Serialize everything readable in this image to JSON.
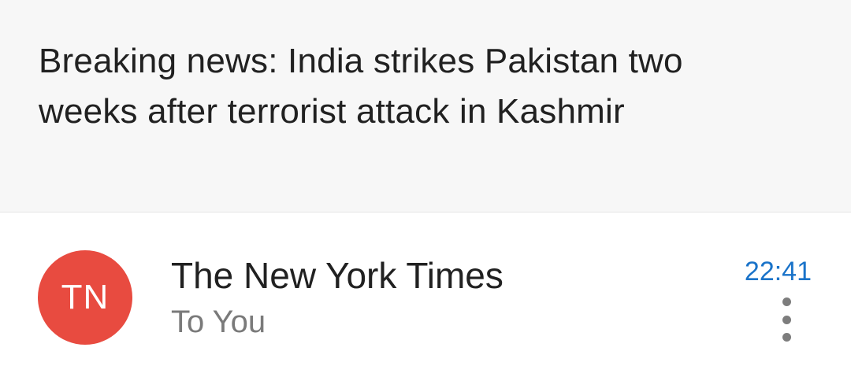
{
  "email": {
    "subject": "Breaking news: India strikes Pakistan two weeks after terrorist attack in Kashmir"
  },
  "sender": {
    "avatar_initials": "TN",
    "avatar_color": "#e84b40",
    "name": "The New York Times",
    "recipient": "To You",
    "time": "22:41",
    "time_color": "#1a73c9",
    "more_icon": "more-vert-icon"
  }
}
